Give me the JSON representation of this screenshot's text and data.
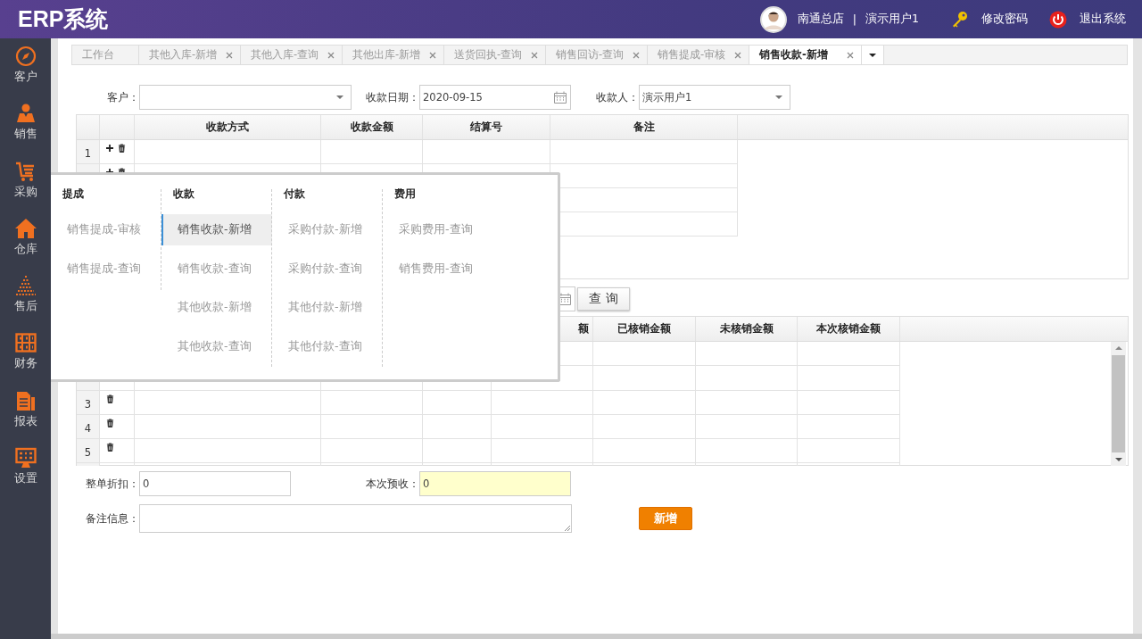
{
  "app": {
    "title": "ERP系统"
  },
  "user_bar": {
    "store": "南通总店",
    "separator": "|",
    "user": "演示用户1",
    "change_password": "修改密码",
    "logout": "退出系统"
  },
  "sidebar": {
    "items": [
      {
        "label": "客户",
        "kind": "compass"
      },
      {
        "label": "销售",
        "kind": "person"
      },
      {
        "label": "采购",
        "kind": "cart"
      },
      {
        "label": "仓库",
        "kind": "house"
      },
      {
        "label": "售后",
        "kind": "bars"
      },
      {
        "label": "财务",
        "kind": "abacus"
      },
      {
        "label": "报表",
        "kind": "document"
      },
      {
        "label": "设置",
        "kind": "monitor"
      }
    ]
  },
  "tabs": [
    {
      "label": "工作台",
      "closable": false,
      "selected": false
    },
    {
      "label": "其他入库-新增",
      "closable": true,
      "selected": false
    },
    {
      "label": "其他入库-查询",
      "closable": true,
      "selected": false
    },
    {
      "label": "其他出库-新增",
      "closable": true,
      "selected": false
    },
    {
      "label": "送货回执-查询",
      "closable": true,
      "selected": false
    },
    {
      "label": "销售回访-查询",
      "closable": true,
      "selected": false
    },
    {
      "label": "销售提成-审核",
      "closable": true,
      "selected": false
    },
    {
      "label": "销售收款-新增",
      "closable": true,
      "selected": true
    }
  ],
  "form": {
    "customer": {
      "label": "客户："
    },
    "date": {
      "label": "收款日期：",
      "value": "2020-09-15"
    },
    "payee": {
      "label": "收款人：",
      "value": "演示用户1"
    }
  },
  "upper_grid": {
    "columns": [
      "收款方式",
      "收款金额",
      "结算号",
      "备注"
    ],
    "rows": [
      {
        "number": "1"
      }
    ]
  },
  "query_button": "查 询",
  "lower_grid": {
    "columns": [
      "额",
      "已核销金额",
      "未核销金额",
      "本次核销金额"
    ],
    "rows": [
      {
        "number": "3"
      },
      {
        "number": "4"
      },
      {
        "number": "5"
      }
    ]
  },
  "footer": {
    "discount": {
      "label": "整单折扣：",
      "value": "0"
    },
    "prepaid": {
      "label": "本次预收：",
      "value": "0"
    },
    "remark": {
      "label": "备注信息："
    },
    "submit": "新增"
  },
  "popup_menu": {
    "columns": [
      {
        "title": "提成",
        "items": [
          {
            "label": "销售提成-审核",
            "selected": false
          },
          {
            "label": "销售提成-查询",
            "selected": false
          }
        ]
      },
      {
        "title": "收款",
        "items": [
          {
            "label": "销售收款-新增",
            "selected": true
          },
          {
            "label": "销售收款-查询",
            "selected": false
          },
          {
            "label": "其他收款-新增",
            "selected": false
          },
          {
            "label": "其他收款-查询",
            "selected": false
          }
        ]
      },
      {
        "title": "付款",
        "items": [
          {
            "label": "采购付款-新增",
            "selected": false
          },
          {
            "label": "采购付款-查询",
            "selected": false
          },
          {
            "label": "其他付款-新增",
            "selected": false
          },
          {
            "label": "其他付款-查询",
            "selected": false
          }
        ]
      },
      {
        "title": "费用",
        "items": [
          {
            "label": "采购费用-查询",
            "selected": false
          },
          {
            "label": "销售费用-查询",
            "selected": false
          }
        ]
      }
    ]
  }
}
